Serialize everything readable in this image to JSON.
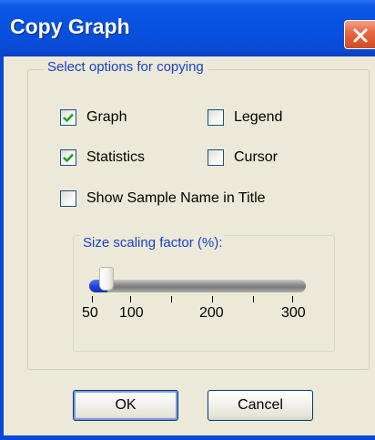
{
  "window": {
    "title": "Copy Graph"
  },
  "group": {
    "label": "Select options for copying"
  },
  "options": {
    "graph": {
      "label": "Graph",
      "checked": true
    },
    "legend": {
      "label": "Legend",
      "checked": false
    },
    "statistics": {
      "label": "Statistics",
      "checked": true
    },
    "cursor": {
      "label": "Cursor",
      "checked": false
    },
    "show_sample_name": {
      "label": "Show Sample Name in Title",
      "checked": false
    }
  },
  "scaling": {
    "label": "Size scaling factor (%):",
    "value": 50,
    "min": 50,
    "max": 300,
    "tick_labels": [
      "50",
      "100",
      "200",
      "300"
    ]
  },
  "buttons": {
    "ok": "OK",
    "cancel": "Cancel"
  },
  "colors": {
    "title_bar": "#0650e0",
    "group_label": "#1a40d0",
    "dialog_bg": "#ece9d8",
    "slider_fill": "#2143d8"
  },
  "icons": {
    "close": "close-icon",
    "check": "check-icon"
  }
}
